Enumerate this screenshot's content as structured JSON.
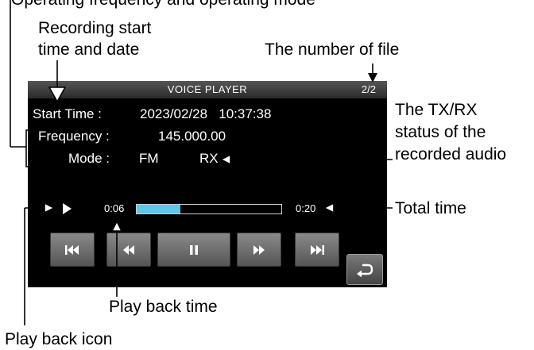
{
  "callouts": {
    "top_partial": "Operating frequency and operating mode",
    "recording_start_line1": "Recording start",
    "recording_start_line2": "time and date",
    "file_number": "The number of file",
    "txrx_line1": "The TX/RX",
    "txrx_line2": "status of the",
    "txrx_line3": "recorded audio",
    "total_time": "Total time",
    "play_back_time": "Play back time",
    "play_back_icon": "Play back icon"
  },
  "player": {
    "title": "VOICE PLAYER",
    "file_count": "2/2",
    "start_time_label": "Start Time :",
    "start_time_value": "2023/02/28   10:37:38",
    "frequency_label": "Frequency :",
    "frequency_value": "145.000.00",
    "mode_label": "Mode :",
    "mode_value": "FM",
    "txrx_value": "RX",
    "elapsed": "0:06",
    "total": "0:20",
    "progress_fraction": 0.3,
    "progress_color": "#5bc8e8",
    "buttons": [
      {
        "name": "skip-previous-button",
        "icon": "skip-previous-icon"
      },
      {
        "name": "rewind-button",
        "icon": "rewind-icon"
      },
      {
        "name": "pause-button",
        "icon": "pause-icon"
      },
      {
        "name": "fast-forward-button",
        "icon": "fast-forward-icon"
      },
      {
        "name": "skip-next-button",
        "icon": "skip-next-icon"
      },
      {
        "name": "return-button",
        "icon": "return-icon"
      }
    ]
  }
}
